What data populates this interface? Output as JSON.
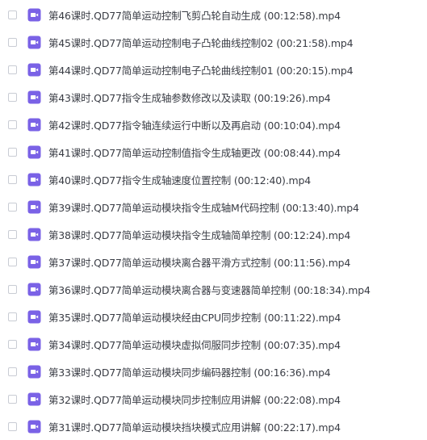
{
  "icon_color": "#7a62e6",
  "icon_name": "video-file-icon",
  "files": [
    {
      "name": "第46课时.QD77简单运动控制飞剪凸轮自动生成 (00:12:58).mp4"
    },
    {
      "name": "第45课时.QD77简单运动控制电子凸轮曲线控制02 (00:21:58).mp4"
    },
    {
      "name": "第44课时.QD77简单运动控制电子凸轮曲线控制01 (00:20:15).mp4"
    },
    {
      "name": "第43课时.QD77指令生成轴参数修改以及读取 (00:19:26).mp4"
    },
    {
      "name": "第42课时.QD77指令轴连续运行中断以及再启动 (00:10:04).mp4"
    },
    {
      "name": "第41课时.QD77简单运动控制值指令生成轴更改 (00:08:44).mp4"
    },
    {
      "name": "第40课时.QD77指令生成轴速度位置控制 (00:12:40).mp4"
    },
    {
      "name": "第39课时.QD77简单运动模块指令生成轴M代码控制 (00:13:40).mp4"
    },
    {
      "name": "第38课时.QD77简单运动模块指令生成轴简单控制 (00:12:24).mp4"
    },
    {
      "name": "第37课时.QD77简单运动模块离合器平滑方式控制 (00:11:56).mp4"
    },
    {
      "name": "第36课时.QD77简单运动模块离合器与变速器简单控制 (00:18:34).mp4"
    },
    {
      "name": "第35课时.QD77简单运动模块经由CPU同步控制 (00:11:22).mp4"
    },
    {
      "name": "第34课时.QD77简单运动模块虚拟伺服同步控制 (00:07:35).mp4"
    },
    {
      "name": "第33课时.QD77简单运动模块同步编码器控制 (00:16:36).mp4"
    },
    {
      "name": "第32课时.QD77简单运动模块同步控制应用讲解 (00:22:08).mp4"
    },
    {
      "name": "第31课时.QD77简单运动模块挡块模式应用讲解 (00:22:17).mp4"
    }
  ]
}
